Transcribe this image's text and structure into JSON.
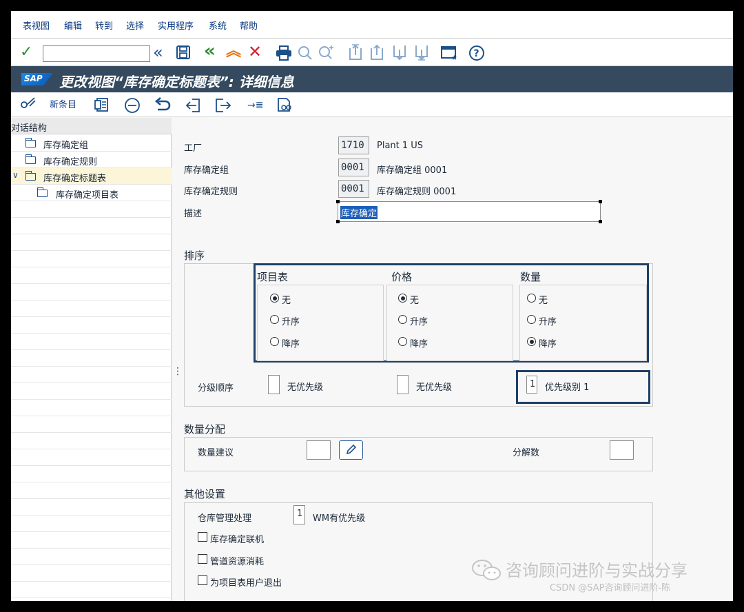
{
  "menu": {
    "items": [
      "表视图",
      "编辑",
      "转到",
      "选择",
      "实用程序",
      "系统",
      "帮助"
    ]
  },
  "toolbar": {
    "command_value": "",
    "icons": [
      "check-icon",
      "back-double-icon",
      "save-icon",
      "exit-icon",
      "up-icon",
      "cancel-icon",
      "print-icon",
      "find-icon",
      "find-next-icon",
      "first-page-icon",
      "prev-page-icon",
      "next-page-icon",
      "last-page-icon",
      "layout-icon",
      "help-icon"
    ]
  },
  "title": {
    "logo": "SAP",
    "text": "更改视图“库存确定标题表”: 详细信息"
  },
  "apptoolbar": {
    "new_entries": "新条目"
  },
  "tree": {
    "header": "对话结构",
    "items": [
      {
        "label": "库存确定组"
      },
      {
        "label": "库存确定规则"
      },
      {
        "label": "库存确定标题表"
      },
      {
        "label": "库存确定项目表"
      }
    ]
  },
  "fields": {
    "plant": {
      "label": "工厂",
      "value": "1710",
      "text": "Plant 1 US"
    },
    "group": {
      "label": "库存确定组",
      "value": "0001",
      "text": "库存确定组 0001"
    },
    "rule": {
      "label": "库存确定规则",
      "value": "0001",
      "text": "库存确定规则 0001"
    },
    "desc": {
      "label": "描述",
      "value": "库存确定"
    }
  },
  "sort": {
    "title": "排序",
    "columns": [
      {
        "name": "项目表",
        "options": [
          "无",
          "升序",
          "降序"
        ],
        "selected": 0
      },
      {
        "name": "价格",
        "options": [
          "无",
          "升序",
          "降序"
        ],
        "selected": 0
      },
      {
        "name": "数量",
        "options": [
          "无",
          "升序",
          "降序"
        ],
        "selected": 2
      }
    ],
    "priority_label": "分级顺序",
    "priorities": [
      {
        "value": "",
        "text": "无优先级"
      },
      {
        "value": "",
        "text": "无优先级"
      },
      {
        "value": "1",
        "text": "优先级别 1"
      }
    ]
  },
  "qty": {
    "title": "数量分配",
    "suggest_label": "数量建议",
    "suggest_value": "",
    "split_label": "分解数",
    "split_value": ""
  },
  "other": {
    "title": "其他设置",
    "wm_label": "仓库管理处理",
    "wm_value": "1",
    "wm_text": "WM有优先级",
    "checks": [
      {
        "label": "库存确定联机",
        "checked": false
      },
      {
        "label": "管道资源消耗",
        "checked": false
      },
      {
        "label": "为项目表用户退出",
        "checked": false
      }
    ]
  },
  "watermark": {
    "text": "咨询顾问进阶与实战分享",
    "footer": "CSDN @SAP咨询顾问进阶-陈"
  }
}
